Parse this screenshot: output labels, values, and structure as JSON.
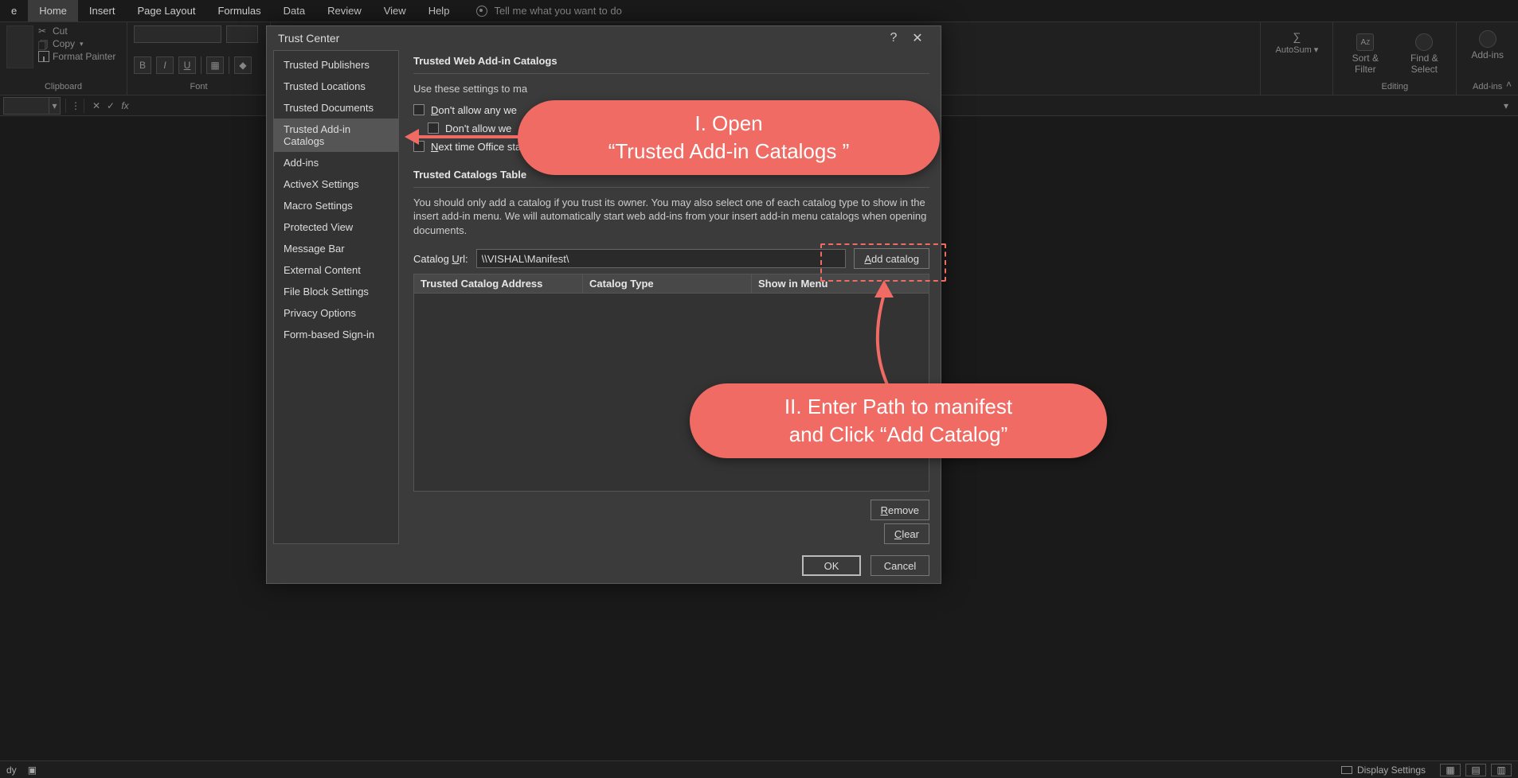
{
  "tabs": {
    "file": "e",
    "home": "Home",
    "insert": "Insert",
    "page_layout": "Page Layout",
    "formulas": "Formulas",
    "data": "Data",
    "review": "Review",
    "view": "View",
    "help": "Help",
    "search_placeholder": "Tell me what you want to do"
  },
  "ribbon": {
    "clipboard": {
      "cut": "Cut",
      "copy": "Copy",
      "format_painter": "Format Painter",
      "group": "Clipboard"
    },
    "font": {
      "group": "Font"
    },
    "editing": {
      "autosum": "AutoSum",
      "sort_filter": "Sort & Filter",
      "find_select": "Find & Select",
      "group": "Editing"
    },
    "addins": {
      "label": "Add-ins",
      "group": "Add-ins"
    }
  },
  "formula_bar": {
    "fx": "fx"
  },
  "dialog": {
    "title": "Trust Center",
    "help_tooltip": "?",
    "close_tooltip": "✕",
    "nav": {
      "trusted_publishers": "Trusted Publishers",
      "trusted_locations": "Trusted Locations",
      "trusted_documents": "Trusted Documents",
      "trusted_addin_catalogs": "Trusted Add-in Catalogs",
      "addins": "Add-ins",
      "activex": "ActiveX Settings",
      "macro": "Macro Settings",
      "protected_view": "Protected View",
      "message_bar": "Message Bar",
      "external_content": "External Content",
      "file_block": "File Block Settings",
      "privacy": "Privacy Options",
      "form_signin": "Form-based Sign-in"
    },
    "section1_title": "Trusted Web Add-in Catalogs",
    "section1_intro": "Use these settings to ma",
    "chk_dont_allow_any": "Don't allow any we",
    "chk_dont_allow_we": "Don't allow we",
    "chk_next_time": "Next time Office sta",
    "section2_title": "Trusted Catalogs Table",
    "section2_intro": "You should only add a catalog if you trust its owner. You may also select one of each catalog type to show in the insert add-in menu. We will automatically start web add-ins from your insert add-in menu catalogs when opening documents.",
    "url_label": "Catalog Url:",
    "url_value": "\\\\VISHAL\\Manifest\\",
    "add_catalog": "Add catalog",
    "col_address": "Trusted Catalog Address",
    "col_type": "Catalog Type",
    "col_show": "Show in Menu",
    "remove": "Remove",
    "clear": "Clear",
    "ok": "OK",
    "cancel": "Cancel"
  },
  "annotations": {
    "c1_l1": "I. Open",
    "c1_l2": "“Trusted Add-in Catalogs ”",
    "c2_l1": "II. Enter Path to manifest",
    "c2_l2": "and Click “Add Catalog”"
  },
  "status": {
    "ready": "dy",
    "display_settings": "Display Settings"
  }
}
